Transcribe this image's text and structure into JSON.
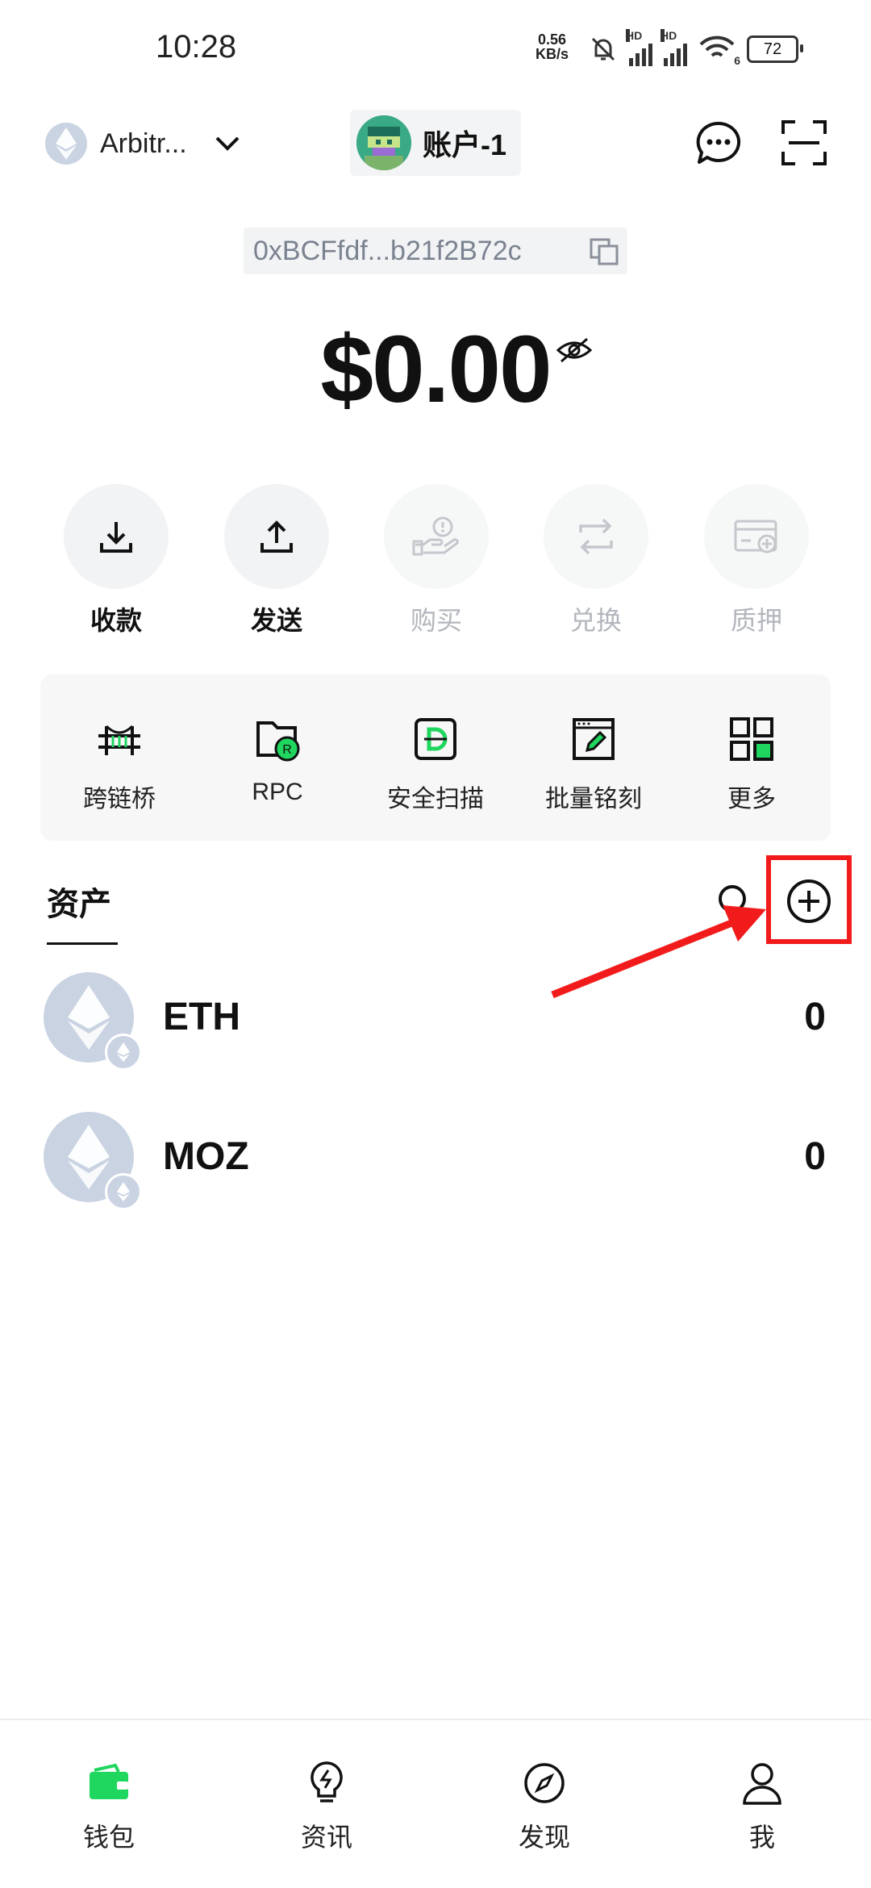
{
  "status_bar": {
    "time": "10:28",
    "net_speed_value": "0.56",
    "net_speed_unit": "KB/s",
    "signal_label_1": "HD",
    "signal_label_2": "HD",
    "wifi_label": "6",
    "battery": "72"
  },
  "header": {
    "network_name": "Arbitr...",
    "account_name": "账户-1"
  },
  "address": "0xBCFfdf...b21f2B72c",
  "balance": "$0.00",
  "actions": [
    {
      "label": "收款",
      "icon": "receive-icon",
      "enabled": true
    },
    {
      "label": "发送",
      "icon": "send-icon",
      "enabled": true
    },
    {
      "label": "购买",
      "icon": "buy-icon",
      "enabled": false
    },
    {
      "label": "兑换",
      "icon": "swap-icon",
      "enabled": false
    },
    {
      "label": "质押",
      "icon": "stake-icon",
      "enabled": false
    }
  ],
  "tools": [
    {
      "label": "跨链桥",
      "icon": "bridge-icon"
    },
    {
      "label": "RPC",
      "icon": "rpc-icon"
    },
    {
      "label": "安全扫描",
      "icon": "security-scan-icon"
    },
    {
      "label": "批量铭刻",
      "icon": "batch-inscribe-icon"
    },
    {
      "label": "更多",
      "icon": "more-grid-icon"
    }
  ],
  "assets": {
    "title": "资产",
    "items": [
      {
        "symbol": "ETH",
        "amount": "0"
      },
      {
        "symbol": "MOZ",
        "amount": "0"
      }
    ]
  },
  "bottom_nav": [
    {
      "label": "钱包",
      "icon": "wallet-icon",
      "active": true
    },
    {
      "label": "资讯",
      "icon": "news-icon",
      "active": false
    },
    {
      "label": "发现",
      "icon": "discover-icon",
      "active": false
    },
    {
      "label": "我",
      "icon": "profile-icon",
      "active": false
    }
  ],
  "colors": {
    "accent_green": "#1fd65f",
    "annotation_red": "#f21b1b",
    "disabled_text": "#b2b6bc",
    "token_gray": "#c9d3e2"
  }
}
